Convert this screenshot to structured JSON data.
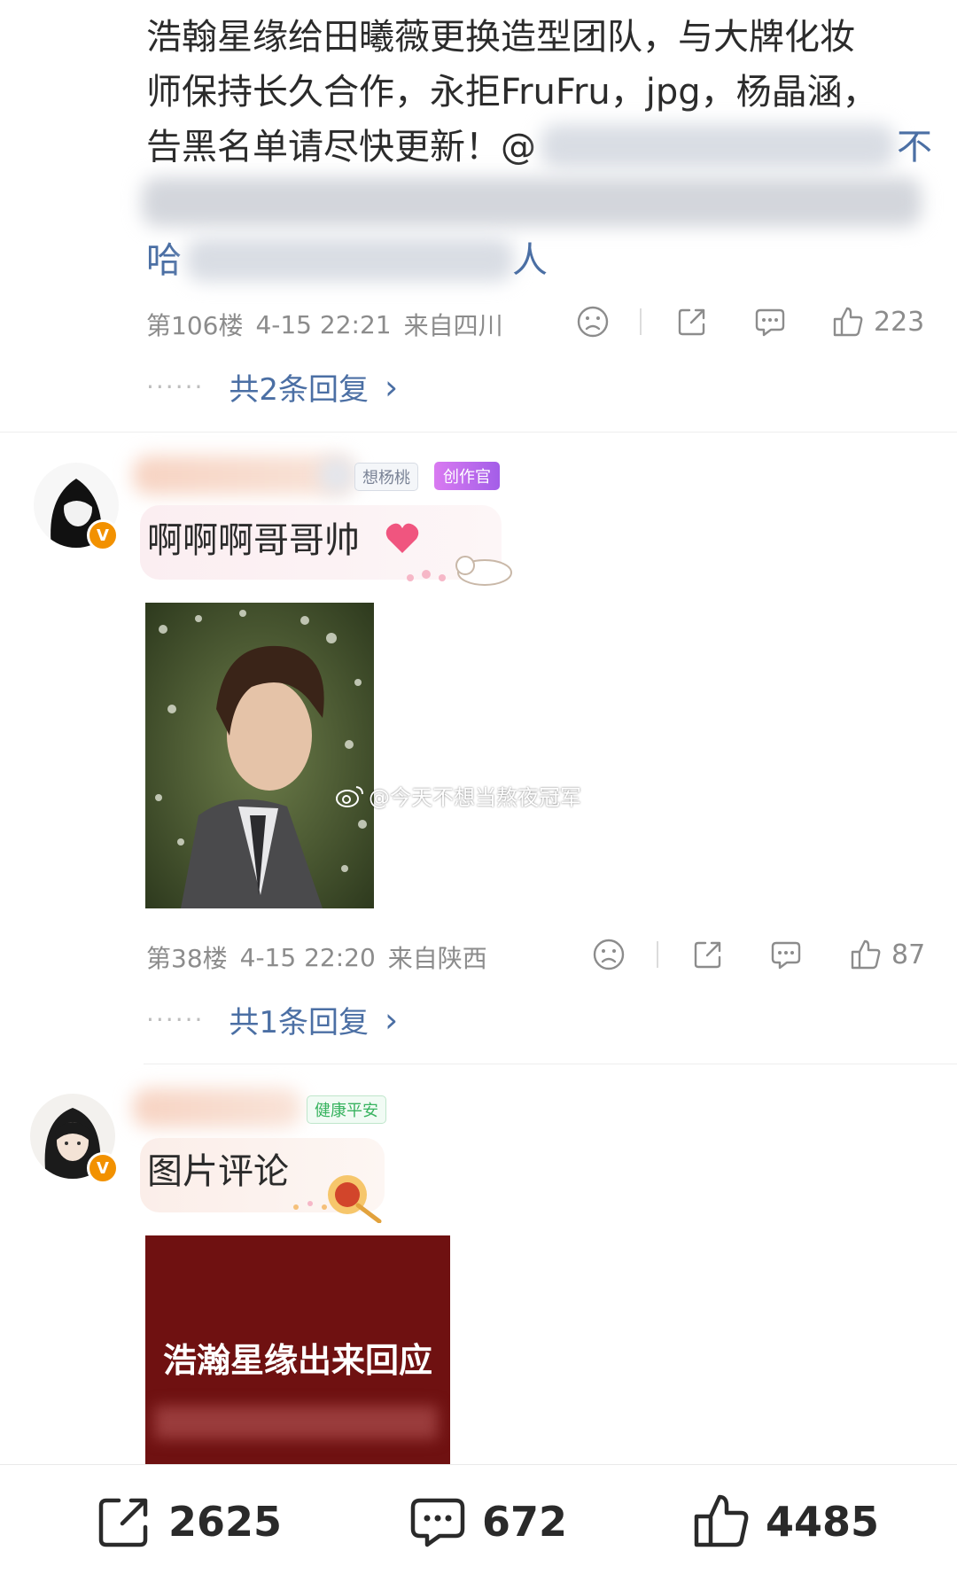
{
  "comment1": {
    "line1": "浩翰星缘给田曦薇更换造型团队，与大牌化妆",
    "line2": "师保持长久合作，永拒FruFru，jpg，杨晶涵，",
    "line3": "告黑名单请尽快更新！@",
    "line3_tail": "不",
    "line5_head": "哈",
    "line5_tail": "人",
    "floor": "第106楼",
    "time": "4-15 22:21",
    "location": "来自四川",
    "likes": "223",
    "replies": "共2条回复",
    "replies_chevron": "›"
  },
  "comment2": {
    "badge_fan": "想杨桃",
    "badge_role": "创作官",
    "text": "啊啊啊哥哥帅",
    "image_watermark": "@今天不想当熬夜冠军",
    "floor": "第38楼",
    "time": "4-15 22:20",
    "location": "来自陕西",
    "likes": "87",
    "replies": "共1条回复",
    "replies_chevron": "›"
  },
  "comment3": {
    "badge_fan": "健康平安",
    "text": "图片评论",
    "image_text": "浩瀚星缘出来回应"
  },
  "bottom_bar": {
    "reposts": "2625",
    "comments": "672",
    "likes": "4485"
  },
  "colors": {
    "link": "#4b6fa4",
    "vip_badge": "#f29100",
    "image2_bg": "#6f1111",
    "role_badge": "#c06be6",
    "fan_badge_green": "#38b35f"
  },
  "icons": [
    "sad-face-icon",
    "share-icon",
    "comment-icon",
    "like-icon",
    "v-badge-icon"
  ]
}
